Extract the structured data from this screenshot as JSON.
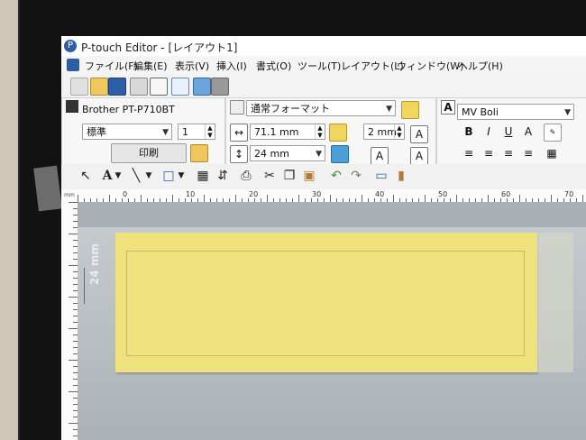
{
  "window": {
    "title": "P-touch Editor - [レイアウト1]"
  },
  "menu": {
    "items": [
      "ファイル(F)",
      "編集(E)",
      "表示(V)",
      "挿入(I)",
      "書式(O)",
      "ツール(T)",
      "レイアウト(L)",
      "ウィンドウ(W)",
      "ヘルプ(H)"
    ]
  },
  "printer_panel": {
    "printer": "Brother PT-P710BT",
    "mode": "標準",
    "copies": "1",
    "print_button": "印刷"
  },
  "format_panel": {
    "format": "通常フォーマット",
    "length": "71.1 mm",
    "tape_width": "24 mm",
    "margin": "2 mm"
  },
  "text_panel": {
    "font": "MV Boli",
    "bold": "B",
    "italic": "I",
    "underline": "U"
  },
  "ruler": {
    "marks": [
      "0",
      "10",
      "20",
      "30",
      "40",
      "50",
      "60",
      "70"
    ],
    "unit": "mm"
  },
  "canvas": {
    "size_label": "24 mm"
  }
}
